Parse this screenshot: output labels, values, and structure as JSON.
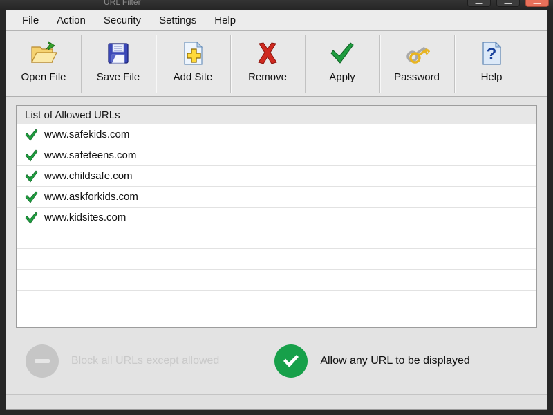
{
  "window": {
    "title": "URL Filter",
    "controls": [
      {
        "name": "minimize",
        "label": "—"
      },
      {
        "name": "maximize",
        "label": "□"
      },
      {
        "name": "close",
        "label": "✕"
      }
    ]
  },
  "menu": {
    "items": [
      {
        "label": "File"
      },
      {
        "label": "Action"
      },
      {
        "label": "Security"
      },
      {
        "label": "Settings"
      },
      {
        "label": "Help"
      }
    ]
  },
  "toolbar": {
    "buttons": [
      {
        "label": "Open File",
        "icon": "open-folder-icon"
      },
      {
        "label": "Save File",
        "icon": "floppy-disk-icon"
      },
      {
        "label": "Add Site",
        "icon": "document-plus-icon"
      },
      {
        "label": "Remove",
        "icon": "red-x-icon"
      },
      {
        "label": "Apply",
        "icon": "green-check-icon"
      },
      {
        "label": "Password",
        "icon": "keys-icon"
      },
      {
        "label": "Help",
        "icon": "question-document-icon"
      }
    ]
  },
  "list": {
    "header": "List of Allowed URLs",
    "rows": [
      {
        "url": "www.safekids.com",
        "allowed": true
      },
      {
        "url": "www.safeteens.com",
        "allowed": true
      },
      {
        "url": "www.childsafe.com",
        "allowed": true
      },
      {
        "url": "www.askforkids.com",
        "allowed": true
      },
      {
        "url": "www.kidsites.com",
        "allowed": true
      }
    ],
    "empty_row_count": 5
  },
  "status": {
    "block_mode": {
      "label": "Block all URLs except allowed",
      "active": false,
      "icon": "minus-circle-icon"
    },
    "allow_mode": {
      "label": "Allow any URL to be displayed",
      "active": true,
      "icon": "check-circle-icon"
    }
  },
  "colors": {
    "green_check": "#1f9c3f",
    "green_circle": "#17a04a",
    "red_x": "#cc2222",
    "gray_off": "#c6c6c6",
    "window_bg": "#e3e3e3",
    "toolbar_bg": "#e8e8e8",
    "title_close": "#e8705a"
  }
}
